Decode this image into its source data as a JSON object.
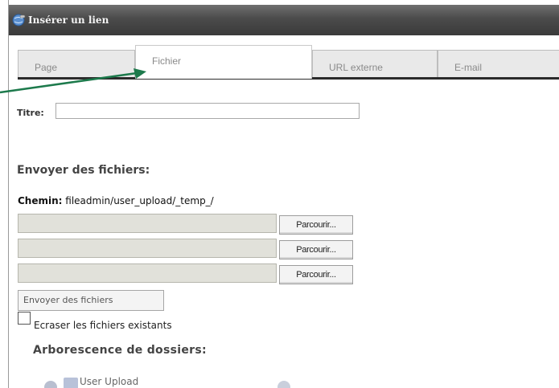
{
  "window": {
    "title": "Insérer un lien",
    "icon": "link-globe-icon"
  },
  "tabs": [
    {
      "label": "Page",
      "active": false
    },
    {
      "label": "Fichier",
      "active": true
    },
    {
      "label": "URL externe",
      "active": false
    },
    {
      "label": "E-mail",
      "active": false
    }
  ],
  "form": {
    "title_label": "Titre:",
    "title_value": "",
    "upload_heading": "Envoyer des fichiers:",
    "path_label": "Chemin:",
    "path_value": "fileadmin/user_upload/_temp_/",
    "browse_label": "Parcourir...",
    "send_button": "Envoyer des fichiers",
    "overwrite_label": "Ecraser les fichiers existants",
    "overwrite_checked": false
  },
  "tree": {
    "heading": "Arborescence de dossiers:",
    "items": [
      {
        "label": "User Upload",
        "icon": "folder-icon"
      }
    ]
  },
  "colors": {
    "titlebar": "#4b4b4b",
    "annotation_arrow": "#1d7a4c",
    "tab_underline": "#2b2b2b"
  }
}
